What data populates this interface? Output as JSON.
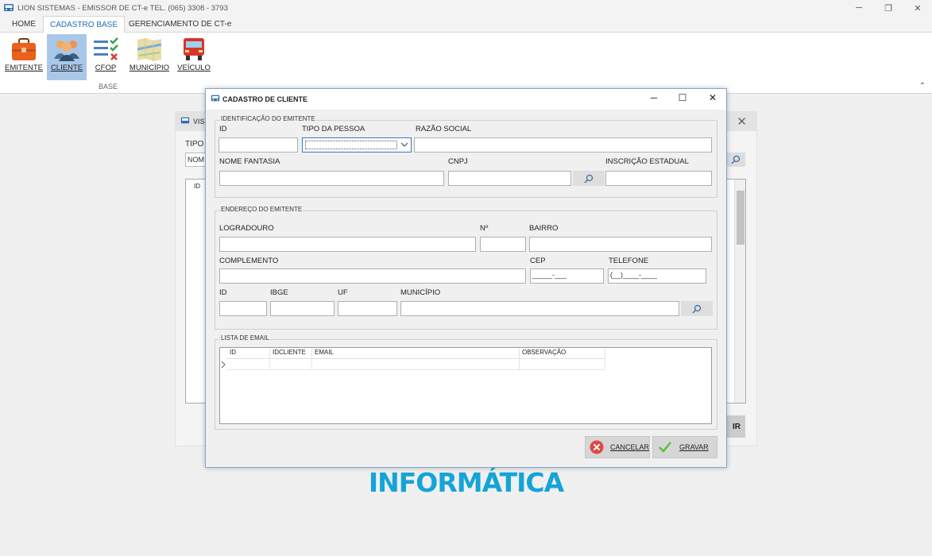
{
  "window": {
    "title": "LION SISTEMAS - EMISSOR DE CT-e  TEL. (065) 3308 - 3793",
    "minimize": "─",
    "restore": "❐",
    "close": "✕"
  },
  "ribbon": {
    "tabs": [
      {
        "label": "HOME"
      },
      {
        "label": "CADASTRO BASE"
      },
      {
        "label": "GERENCIAMENTO DE CT-e"
      }
    ],
    "buttons": [
      {
        "label": "EMITENTE",
        "icon": "briefcase-icon"
      },
      {
        "label": "CLIENTE",
        "icon": "people-icon"
      },
      {
        "label": "CFOP",
        "icon": "checklist-icon"
      },
      {
        "label": "MUNICÍPIO",
        "icon": "map-icon"
      },
      {
        "label": "VEÍCULO",
        "icon": "truck-icon"
      }
    ],
    "group_label": "BASE",
    "collapse": "⌃"
  },
  "background_window": {
    "title": "VIS",
    "close": "✕",
    "tipo_label": "TIPO",
    "combo_value": "NOM",
    "grid_id": "ID",
    "button_tail": "IR"
  },
  "brand_text": "INFORMÁTICA",
  "dialog": {
    "title": "CADASTRO DE CLIENTE",
    "minimize": "─",
    "maximize": "☐",
    "close": "✕",
    "identificacao": {
      "legend": "IDENTIFICAÇÃO DO EMITENTE",
      "id_label": "ID",
      "tipo_pessoa_label": "TIPO DA PESSOA",
      "razao_social_label": "RAZÃO SOCIAL",
      "nome_fantasia_label": "NOME FANTASIA",
      "cnpj_label": "CNPJ",
      "inscricao_label": "INSCRIÇÃO ESTADUAL"
    },
    "endereco": {
      "legend": "ENDEREÇO DO EMITENTE",
      "logradouro_label": "LOGRADOURO",
      "numero_label": "Nº",
      "bairro_label": "BAIRRO",
      "complemento_label": "COMPLEMENTO",
      "cep_label": "CEP",
      "telefone_label": "TELEFONE",
      "cep_mask": "_____-___",
      "telefone_mask": "(__)____-____",
      "id_label": "ID",
      "ibge_label": "IBGE",
      "uf_label": "UF",
      "municipio_label": "MUNICÍPIO"
    },
    "emails": {
      "legend": "LISTA DE EMAIL",
      "columns": [
        "ID",
        "IDCLIENTE",
        "EMAIL",
        "OBSERVAÇÃO"
      ]
    },
    "buttons": {
      "cancel": "CANCELAR",
      "save": "GRAVAR"
    }
  },
  "colors": {
    "accent": "#1f6fb5",
    "ribbon_active": "#a9c7e8",
    "brand": "#14a4d8",
    "cancel": "#e04848",
    "save": "#5cbf3e"
  }
}
